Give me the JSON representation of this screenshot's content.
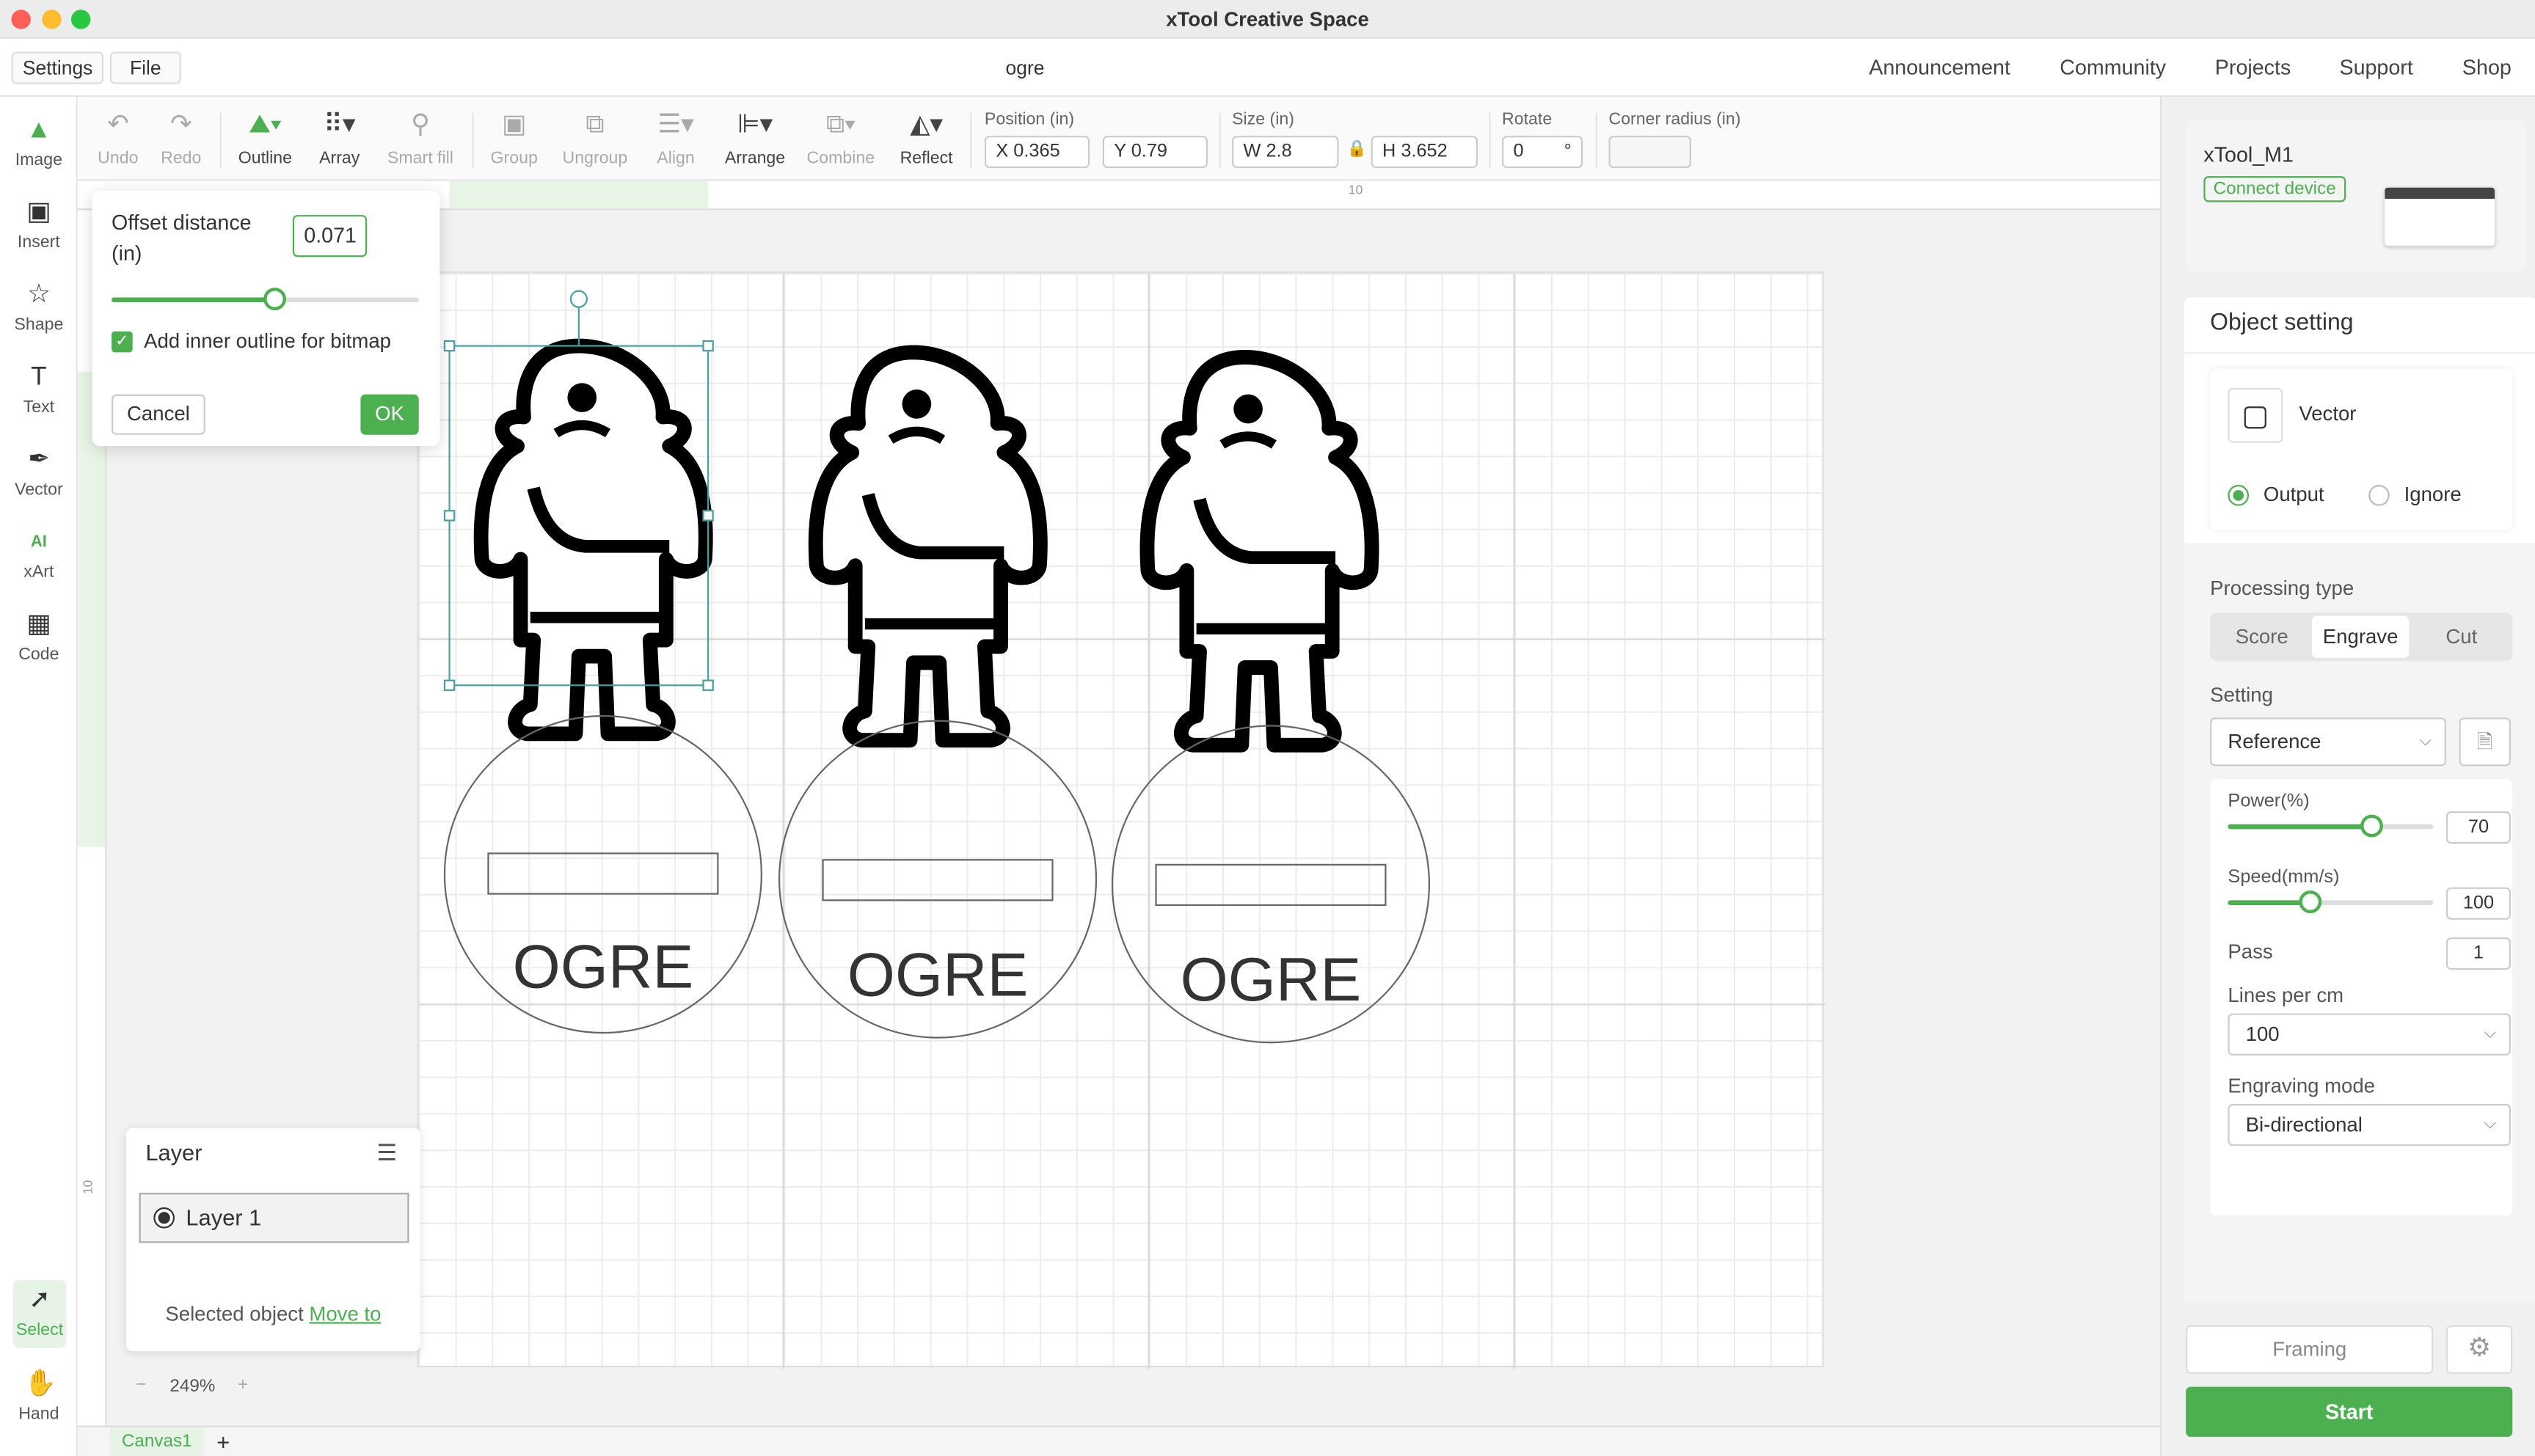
{
  "window": {
    "title": "xTool Creative Space",
    "doc_name": "ogre"
  },
  "menu": {
    "settings": "Settings",
    "file": "File",
    "links": [
      "Announcement",
      "Community",
      "Projects",
      "Support",
      "Shop"
    ]
  },
  "left_tools": [
    {
      "label": "Image",
      "icon": "image-icon"
    },
    {
      "label": "Insert",
      "icon": "insert-icon"
    },
    {
      "label": "Shape",
      "icon": "star-icon"
    },
    {
      "label": "Text",
      "icon": "text-icon"
    },
    {
      "label": "Vector",
      "icon": "pen-icon"
    },
    {
      "label": "xArt",
      "icon": "ai-icon"
    },
    {
      "label": "Code",
      "icon": "qr-icon"
    },
    {
      "label": "Select",
      "icon": "cursor-icon"
    },
    {
      "label": "Hand",
      "icon": "hand-icon"
    }
  ],
  "toolbar": {
    "undo": "Undo",
    "redo": "Redo",
    "outline": "Outline",
    "array": "Array",
    "smart_fill": "Smart fill",
    "group": "Group",
    "ungroup": "Ungroup",
    "align": "Align",
    "arrange": "Arrange",
    "combine": "Combine",
    "reflect": "Reflect"
  },
  "props": {
    "position_label": "Position (in)",
    "x": "X 0.365",
    "y": "Y 0.79",
    "size_label": "Size (in)",
    "w": "W 2.8",
    "h": "H 3.652",
    "rotate_label": "Rotate",
    "rotate": "0",
    "degree": "°",
    "corner_label": "Corner radius (in)",
    "corner": ""
  },
  "ruler": {
    "mark_top": "10",
    "mark_left": "10"
  },
  "outline_popup": {
    "label": "Offset distance (in)",
    "value": "0.071",
    "slider_fraction": 0.53,
    "checkbox_label": "Add inner outline for bitmap",
    "checked": true,
    "cancel": "Cancel",
    "ok": "OK"
  },
  "canvas": {
    "tags": [
      "OGRE",
      "OGRE",
      "OGRE"
    ]
  },
  "layer_panel": {
    "title": "Layer",
    "layer": "Layer 1",
    "selected_text": "Selected object",
    "move_to": "Move to"
  },
  "zoom": {
    "value": "249%",
    "minus": "−",
    "plus": "+"
  },
  "tabs": {
    "canvas": "Canvas1",
    "add": "+"
  },
  "device": {
    "name": "xTool_M1",
    "connect": "Connect device"
  },
  "object_setting": {
    "title": "Object setting",
    "type": "Vector",
    "output": "Output",
    "ignore": "Ignore",
    "output_selected": true,
    "processing_label": "Processing type",
    "processing": [
      "Score",
      "Engrave",
      "Cut"
    ],
    "processing_selected": "Engrave",
    "setting_label": "Setting",
    "setting": "Reference",
    "power_label": "Power(%)",
    "power": "70",
    "speed_label": "Speed(mm/s)",
    "speed": "100",
    "speed_fraction": 0.4,
    "pass_label": "Pass",
    "pass": "1",
    "lines_label": "Lines per cm",
    "lines": "100",
    "mode_label": "Engraving mode",
    "mode": "Bi-directional"
  },
  "actions": {
    "framing": "Framing",
    "start": "Start"
  },
  "colors": {
    "accent": "#4caf50"
  }
}
